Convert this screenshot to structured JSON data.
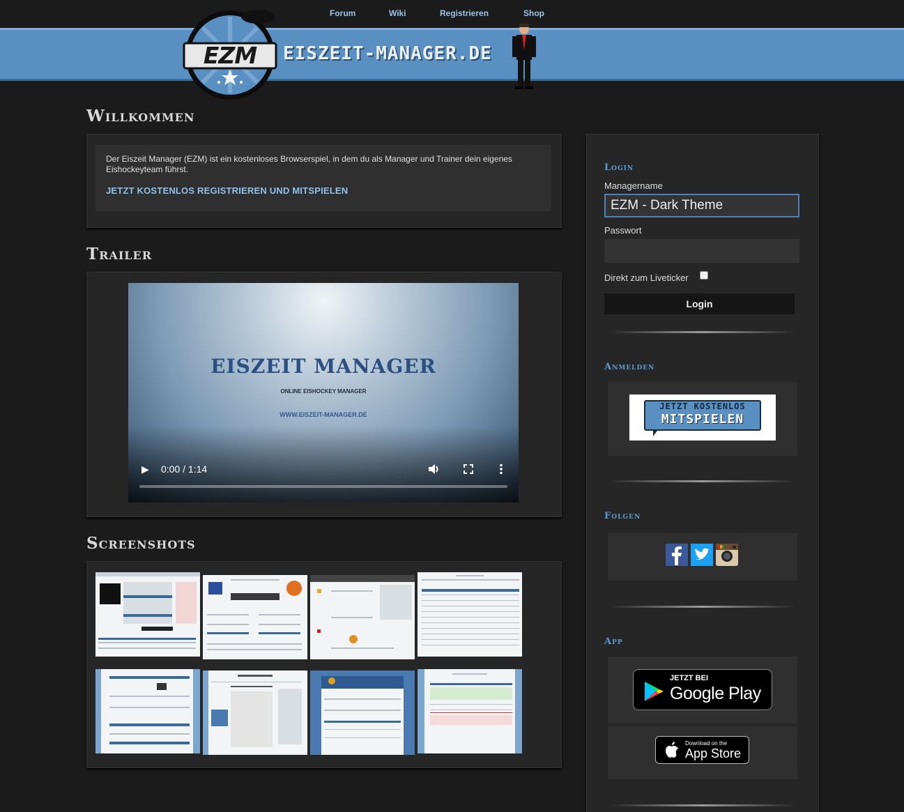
{
  "nav": {
    "items": [
      "Forum",
      "Wiki",
      "Registrieren",
      "Shop"
    ]
  },
  "brand": {
    "logo_text": "EZM",
    "site_name": "EISZEIT-MANAGER.DE"
  },
  "welcome": {
    "heading": "Willkommen",
    "text": "Der Eiszeit Manager (EZM) ist ein kostenloses Browserspiel, in dem du als Manager und Trainer dein eigenes Eishockeyteam führst.",
    "cta_link": "JETZT KOSTENLOS REGISTRIEREN UND MITSPIELEN"
  },
  "trailer": {
    "heading": "Trailer",
    "video_title": "EISZEIT MANAGER",
    "video_subtitle": "ONLINE EISHOCKEY MANAGER",
    "video_url": "WWW.EISZEIT-MANAGER.DE",
    "time": "0:00 / 1:14",
    "progress": 0
  },
  "screenshots": {
    "heading": "Screenshots",
    "count": 8
  },
  "login": {
    "heading": "Login",
    "username_label": "Managername",
    "username_value": "EZM - Dark Theme",
    "password_label": "Passwort",
    "liveticker_label": "Direkt zum Liveticker",
    "liveticker_checked": false,
    "button_label": "Login"
  },
  "signup": {
    "heading": "Anmelden",
    "badge_line1": "JETZT KOSTENLOS",
    "badge_line2": "MITSPIELEN"
  },
  "follow": {
    "heading": "Folgen",
    "icons": [
      "facebook-icon",
      "twitter-icon",
      "instagram-icon"
    ]
  },
  "app": {
    "heading": "App",
    "google_small": "JETZT BEI",
    "google_big": "Google Play",
    "apple_small": "Download on the",
    "apple_big": "App Store"
  },
  "colors": {
    "background": "#1b1b1b",
    "banner": "#5a8fc1",
    "link": "#8fc0ec",
    "sidebar_heading": "#5a9bd6"
  }
}
